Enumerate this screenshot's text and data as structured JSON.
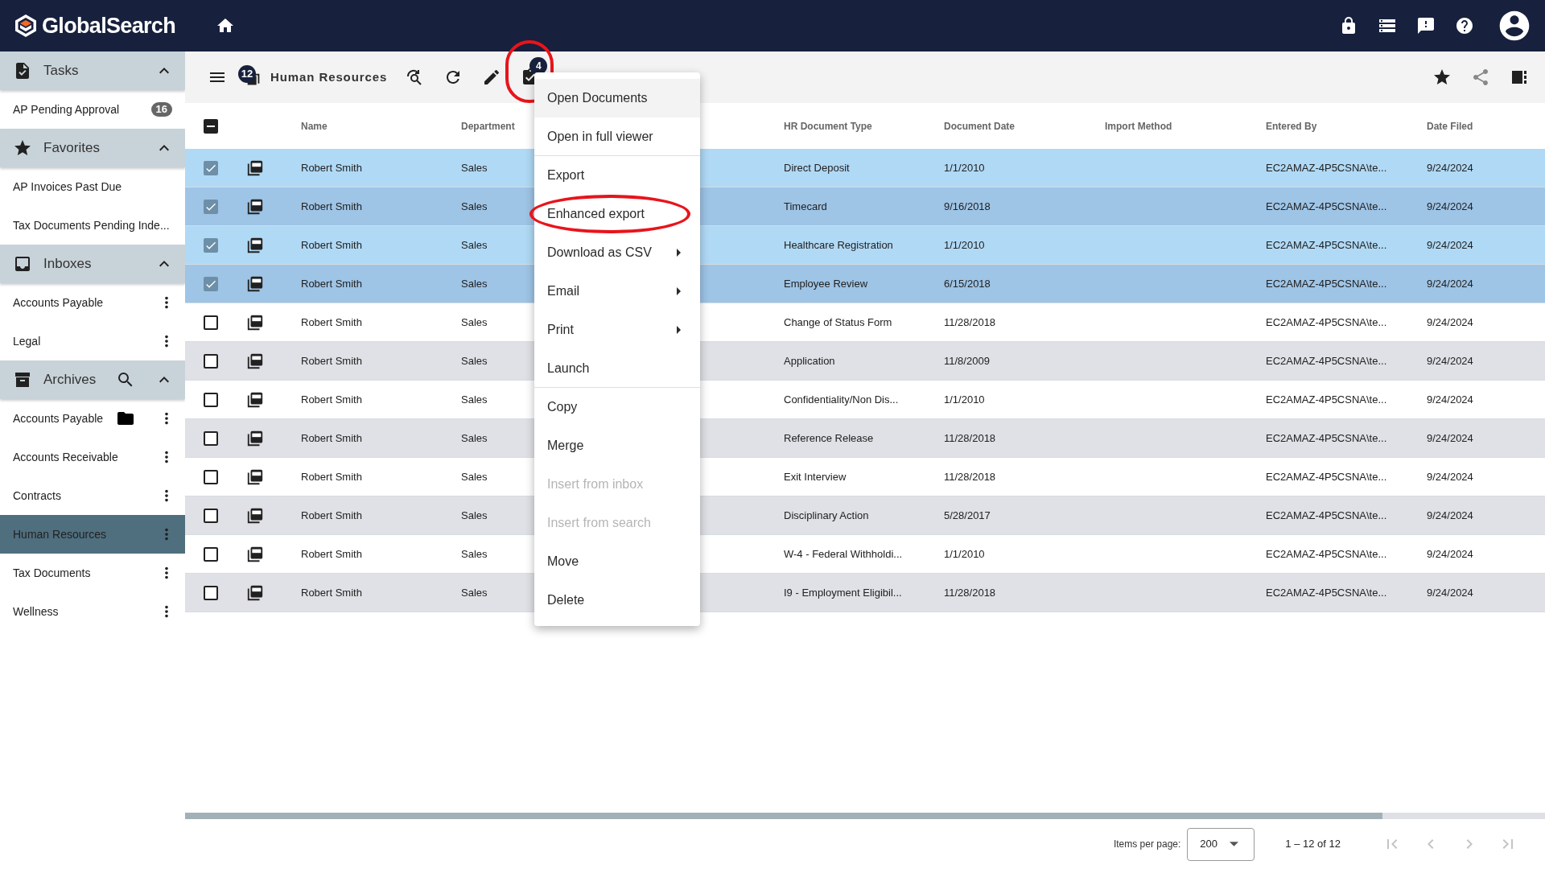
{
  "app": {
    "title": "GlobalSearch"
  },
  "sidebar": {
    "sections": [
      {
        "title": "Tasks",
        "expanded": true,
        "search": false,
        "items": [
          {
            "label": "AP Pending Approval",
            "badge": "16",
            "menu": false,
            "folder": false,
            "selected": false
          }
        ]
      },
      {
        "title": "Favorites",
        "expanded": true,
        "search": false,
        "items": [
          {
            "label": "AP Invoices Past Due",
            "menu": false,
            "folder": false,
            "selected": false
          },
          {
            "label": "Tax Documents Pending Inde...",
            "menu": false,
            "folder": false,
            "selected": false
          }
        ]
      },
      {
        "title": "Inboxes",
        "expanded": true,
        "search": false,
        "items": [
          {
            "label": "Accounts Payable",
            "menu": true,
            "folder": false,
            "selected": false
          },
          {
            "label": "Legal",
            "menu": true,
            "folder": false,
            "selected": false
          }
        ]
      },
      {
        "title": "Archives",
        "expanded": true,
        "search": true,
        "items": [
          {
            "label": "Accounts Payable",
            "menu": true,
            "folder": true,
            "selected": false
          },
          {
            "label": "Accounts Receivable",
            "menu": true,
            "folder": false,
            "selected": false
          },
          {
            "label": "Contracts",
            "menu": true,
            "folder": false,
            "selected": false
          },
          {
            "label": "Human Resources",
            "menu": true,
            "folder": false,
            "selected": true
          },
          {
            "label": "Tax Documents",
            "menu": true,
            "folder": false,
            "selected": false
          },
          {
            "label": "Wellness",
            "menu": true,
            "folder": false,
            "selected": false
          }
        ]
      }
    ]
  },
  "toolbar": {
    "count_badge": "12",
    "title": "Human Resources",
    "selection_badge": "4",
    "selection_circled": true
  },
  "table": {
    "indeterminate": true,
    "columns": [
      "Name",
      "Department",
      "HR Document Type",
      "Document Date",
      "Import Method",
      "Entered By",
      "Date Filed"
    ],
    "rows": [
      {
        "selected": true,
        "cells": [
          "Robert Smith",
          "Sales",
          "Direct Deposit",
          "1/1/2010",
          "",
          "EC2AMAZ-4P5CSNA\\te...",
          "9/24/2024"
        ]
      },
      {
        "selected": true,
        "cells": [
          "Robert Smith",
          "Sales",
          "Timecard",
          "9/16/2018",
          "",
          "EC2AMAZ-4P5CSNA\\te...",
          "9/24/2024"
        ]
      },
      {
        "selected": true,
        "cells": [
          "Robert Smith",
          "Sales",
          "Healthcare Registration",
          "1/1/2010",
          "",
          "EC2AMAZ-4P5CSNA\\te...",
          "9/24/2024"
        ]
      },
      {
        "selected": true,
        "cells": [
          "Robert Smith",
          "Sales",
          "Employee Review",
          "6/15/2018",
          "",
          "EC2AMAZ-4P5CSNA\\te...",
          "9/24/2024"
        ]
      },
      {
        "selected": false,
        "cells": [
          "Robert Smith",
          "Sales",
          "Change of Status Form",
          "11/28/2018",
          "",
          "EC2AMAZ-4P5CSNA\\te...",
          "9/24/2024"
        ]
      },
      {
        "selected": false,
        "cells": [
          "Robert Smith",
          "Sales",
          "Application",
          "11/8/2009",
          "",
          "EC2AMAZ-4P5CSNA\\te...",
          "9/24/2024"
        ]
      },
      {
        "selected": false,
        "cells": [
          "Robert Smith",
          "Sales",
          "Confidentiality/Non Dis...",
          "1/1/2010",
          "",
          "EC2AMAZ-4P5CSNA\\te...",
          "9/24/2024"
        ]
      },
      {
        "selected": false,
        "cells": [
          "Robert Smith",
          "Sales",
          "Reference Release",
          "11/28/2018",
          "",
          "EC2AMAZ-4P5CSNA\\te...",
          "9/24/2024"
        ]
      },
      {
        "selected": false,
        "cells": [
          "Robert Smith",
          "Sales",
          "Exit Interview",
          "11/28/2018",
          "",
          "EC2AMAZ-4P5CSNA\\te...",
          "9/24/2024"
        ]
      },
      {
        "selected": false,
        "cells": [
          "Robert Smith",
          "Sales",
          "Disciplinary Action",
          "5/28/2017",
          "",
          "EC2AMAZ-4P5CSNA\\te...",
          "9/24/2024"
        ]
      },
      {
        "selected": false,
        "cells": [
          "Robert Smith",
          "Sales",
          "W-4 - Federal Withholdi...",
          "1/1/2010",
          "",
          "EC2AMAZ-4P5CSNA\\te...",
          "9/24/2024"
        ]
      },
      {
        "selected": false,
        "cells": [
          "Robert Smith",
          "Sales",
          "I9 - Employment Eligibil...",
          "11/28/2018",
          "",
          "EC2AMAZ-4P5CSNA\\te...",
          "9/24/2024"
        ]
      }
    ]
  },
  "context_menu": {
    "items": [
      {
        "label": "Open Documents",
        "disabled": false,
        "submenu": false,
        "divider_after": false,
        "hovered": true,
        "circled": false
      },
      {
        "label": "Open in full viewer",
        "disabled": false,
        "submenu": false,
        "divider_after": true,
        "hovered": false,
        "circled": false
      },
      {
        "label": "Export",
        "disabled": false,
        "submenu": false,
        "divider_after": false,
        "hovered": false,
        "circled": false
      },
      {
        "label": "Enhanced export",
        "disabled": false,
        "submenu": false,
        "divider_after": false,
        "hovered": false,
        "circled": true
      },
      {
        "label": "Download as CSV",
        "disabled": false,
        "submenu": true,
        "divider_after": false,
        "hovered": false,
        "circled": false
      },
      {
        "label": "Email",
        "disabled": false,
        "submenu": true,
        "divider_after": false,
        "hovered": false,
        "circled": false
      },
      {
        "label": "Print",
        "disabled": false,
        "submenu": true,
        "divider_after": false,
        "hovered": false,
        "circled": false
      },
      {
        "label": "Launch",
        "disabled": false,
        "submenu": false,
        "divider_after": true,
        "hovered": false,
        "circled": false
      },
      {
        "label": "Copy",
        "disabled": false,
        "submenu": false,
        "divider_after": false,
        "hovered": false,
        "circled": false
      },
      {
        "label": "Merge",
        "disabled": false,
        "submenu": false,
        "divider_after": false,
        "hovered": false,
        "circled": false
      },
      {
        "label": "Insert from inbox",
        "disabled": true,
        "submenu": false,
        "divider_after": false,
        "hovered": false,
        "circled": false
      },
      {
        "label": "Insert from search",
        "disabled": true,
        "submenu": false,
        "divider_after": false,
        "hovered": false,
        "circled": false
      },
      {
        "label": "Move",
        "disabled": false,
        "submenu": false,
        "divider_after": false,
        "hovered": false,
        "circled": false
      },
      {
        "label": "Delete",
        "disabled": false,
        "submenu": false,
        "divider_after": false,
        "hovered": false,
        "circled": false
      }
    ]
  },
  "paginator": {
    "label": "Items per page:",
    "page_size": "200",
    "range": "1 – 12 of 12",
    "first_disabled": true,
    "prev_disabled": true,
    "next_disabled": true,
    "last_disabled": true
  }
}
